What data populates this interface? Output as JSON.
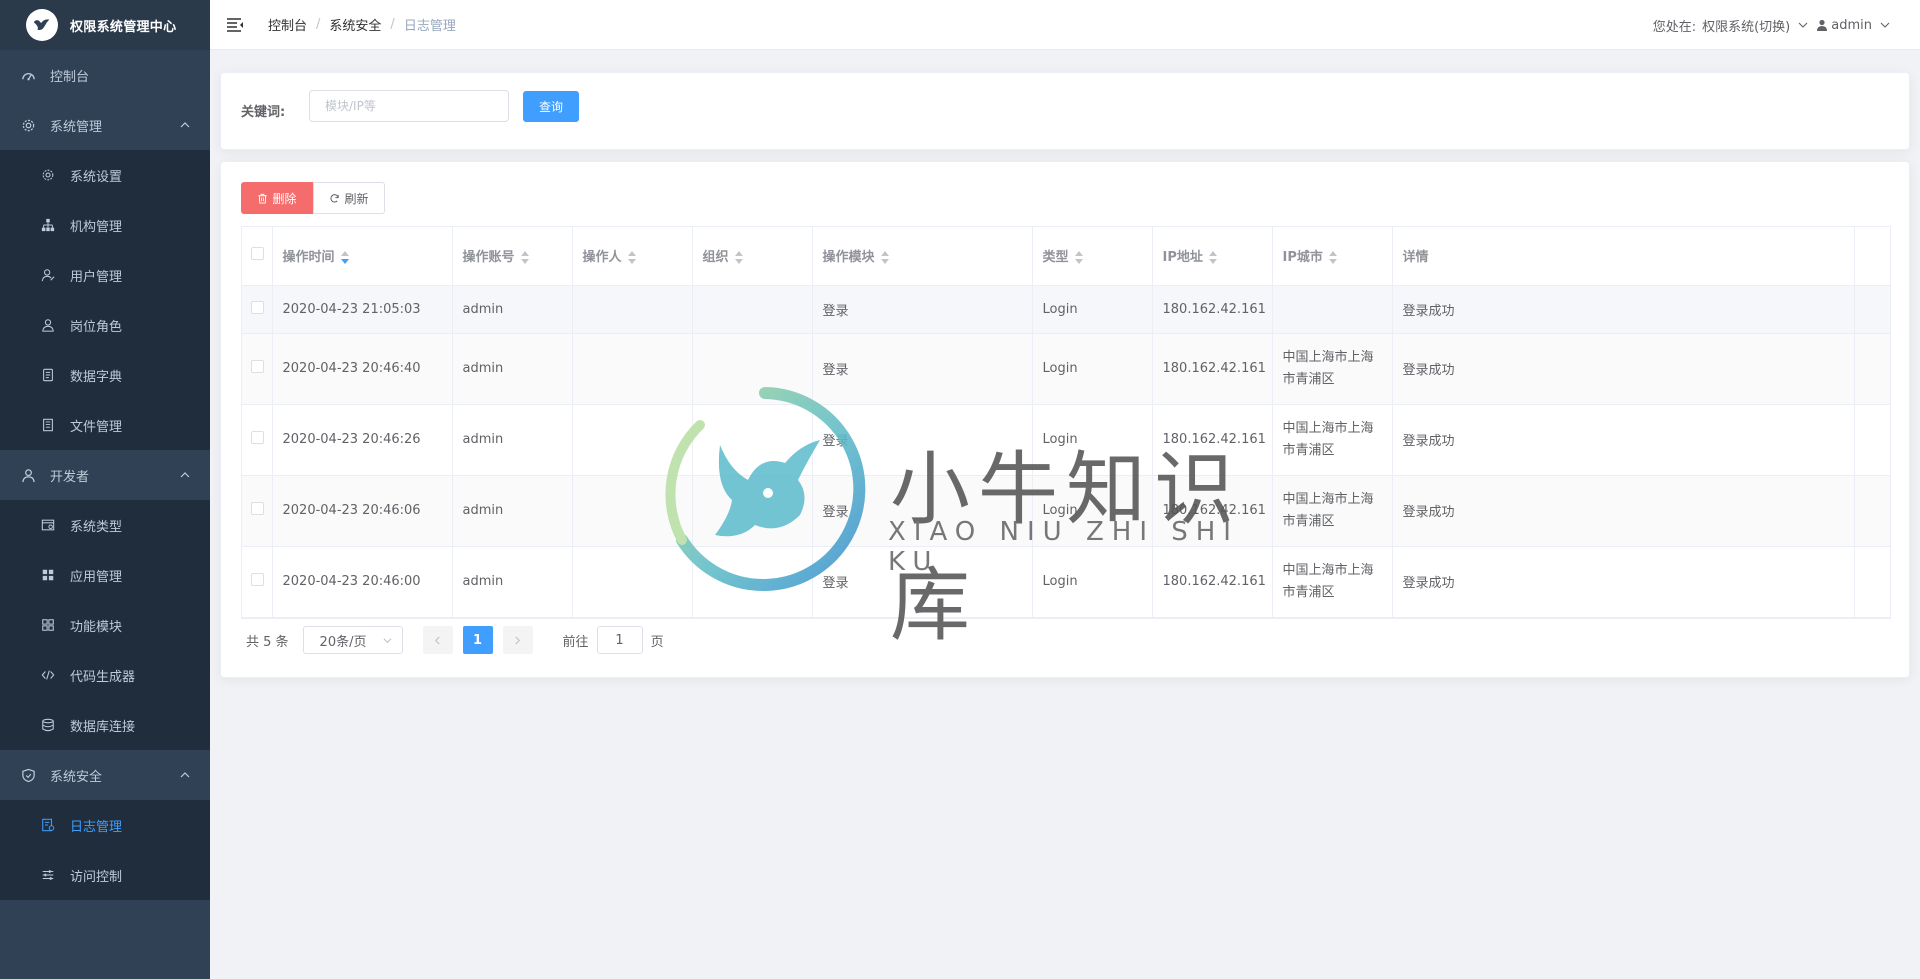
{
  "app": {
    "title": "权限系统管理中心"
  },
  "sidebar": {
    "groups": [
      {
        "label": "控制台",
        "icon": "dashboard-icon",
        "items": []
      },
      {
        "label": "系统管理",
        "icon": "gear-icon",
        "expanded": true,
        "items": [
          {
            "label": "系统设置",
            "icon": "gear-icon"
          },
          {
            "label": "机构管理",
            "icon": "org-tree-icon"
          },
          {
            "label": "用户管理",
            "icon": "user-icon"
          },
          {
            "label": "岗位角色",
            "icon": "role-icon"
          },
          {
            "label": "数据字典",
            "icon": "dictionary-icon"
          },
          {
            "label": "文件管理",
            "icon": "document-icon"
          }
        ]
      },
      {
        "label": "开发者",
        "icon": "developer-icon",
        "expanded": true,
        "items": [
          {
            "label": "系统类型",
            "icon": "window-icon"
          },
          {
            "label": "应用管理",
            "icon": "grid-icon"
          },
          {
            "label": "功能模块",
            "icon": "modules-icon"
          },
          {
            "label": "代码生成器",
            "icon": "code-icon"
          },
          {
            "label": "数据库连接",
            "icon": "database-icon"
          }
        ]
      },
      {
        "label": "系统安全",
        "icon": "shield-icon",
        "expanded": true,
        "items": [
          {
            "label": "日志管理",
            "icon": "log-icon",
            "active": true
          },
          {
            "label": "访问控制",
            "icon": "sliders-icon"
          }
        ]
      }
    ]
  },
  "header": {
    "breadcrumb": [
      "控制台",
      "系统安全",
      "日志管理"
    ],
    "location_prefix": "您处在:",
    "system_switch": "权限系统(切换)",
    "username": "admin"
  },
  "search": {
    "label": "关键词:",
    "placeholder": "模块/IP等",
    "value": "",
    "button": "查询"
  },
  "toolbar": {
    "delete_label": "删除",
    "refresh_label": "刷新"
  },
  "table": {
    "columns": [
      "操作时间",
      "操作账号",
      "操作人",
      "组织",
      "操作模块",
      "类型",
      "IP地址",
      "IP城市",
      "详情"
    ],
    "rows": [
      [
        "2020-04-23 21:05:03",
        "admin",
        "",
        "",
        "登录",
        "Login",
        "180.162.42.161",
        "",
        "登录成功"
      ],
      [
        "2020-04-23 20:46:40",
        "admin",
        "",
        "",
        "登录",
        "Login",
        "180.162.42.161",
        "中国上海市上海市青浦区",
        "登录成功"
      ],
      [
        "2020-04-23 20:46:26",
        "admin",
        "",
        "",
        "登录",
        "Login",
        "180.162.42.161",
        "中国上海市上海市青浦区",
        "登录成功"
      ],
      [
        "2020-04-23 20:46:06",
        "admin",
        "",
        "",
        "登录",
        "Login",
        "180.162.42.161",
        "中国上海市上海市青浦区",
        "登录成功"
      ],
      [
        "2020-04-23 20:46:00",
        "admin",
        "",
        "",
        "登录",
        "Login",
        "180.162.42.161",
        "中国上海市上海市青浦区",
        "登录成功"
      ]
    ]
  },
  "pagination": {
    "total_label": "共 5 条",
    "page_size": "20条/页",
    "current_page": "1",
    "goto_label": "前往",
    "goto_value": "1",
    "page_suffix": "页"
  },
  "watermark": {
    "cn": "小牛知识库",
    "en": "XIAO NIU ZHI SHI KU"
  },
  "colors": {
    "sidebar_bg": "#304156",
    "submenu_bg": "#1f2d3d",
    "primary": "#409eff",
    "danger": "#f56c6c"
  }
}
